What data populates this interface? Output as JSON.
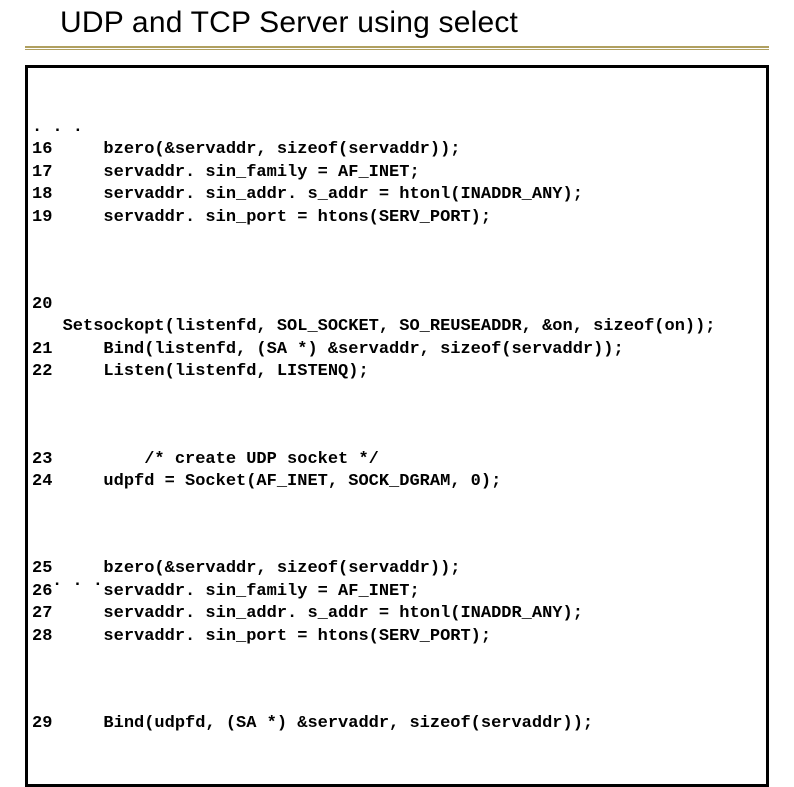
{
  "title": "UDP and TCP Server using select",
  "code": {
    "block1": ". . .\n16     bzero(&servaddr, sizeof(servaddr));\n17     servaddr. sin_family = AF_INET;\n18     servaddr. sin_addr. s_addr = htonl(INADDR_ANY);\n19     servaddr. sin_port = htons(SERV_PORT);",
    "block2": "20\n   Setsockopt(listenfd, SOL_SOCKET, SO_REUSEADDR, &on, sizeof(on));\n21     Bind(listenfd, (SA *) &servaddr, sizeof(servaddr));\n22     Listen(listenfd, LISTENQ);",
    "block3": "23         /* create UDP socket */\n24     udpfd = Socket(AF_INET, SOCK_DGRAM, 0);",
    "block4": "25     bzero(&servaddr, sizeof(servaddr));\n26     servaddr. sin_family = AF_INET;\n27     servaddr. sin_addr. s_addr = htonl(INADDR_ANY);\n28     servaddr. sin_port = htons(SERV_PORT);",
    "block5": "29     Bind(udpfd, (SA *) &servaddr, sizeof(servaddr));"
  },
  "trailing": ". . ."
}
